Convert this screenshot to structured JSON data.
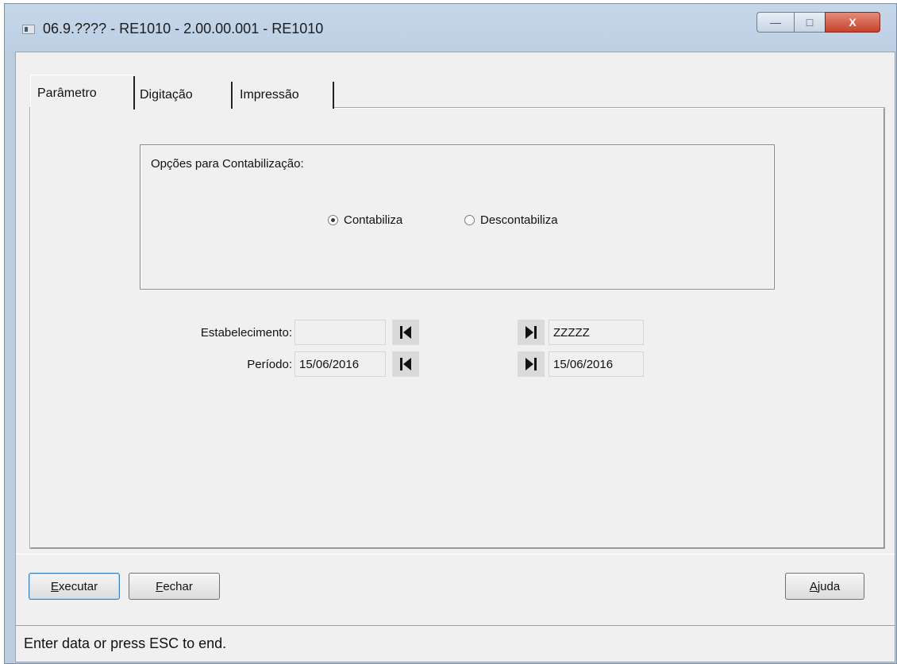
{
  "window": {
    "title": "06.9.???? - RE1010 - 2.00.00.001 - RE1010",
    "controls": {
      "minimize": "—",
      "maximize": "□",
      "close": "X"
    }
  },
  "tabs": [
    {
      "label": "Parâmetro",
      "active": true
    },
    {
      "label": "Digitação",
      "active": false
    },
    {
      "label": "Impressão",
      "active": false
    }
  ],
  "options_group": {
    "label": "Opções para Contabilização:",
    "radios": [
      {
        "label": "Contabiliza",
        "selected": true
      },
      {
        "label": "Descontabiliza",
        "selected": false
      }
    ]
  },
  "fields": {
    "estabelecimento": {
      "label": "Estabelecimento:",
      "from": "",
      "to": "ZZZZZ"
    },
    "periodo": {
      "label": "Período:",
      "from": "15/06/2016",
      "to": "15/06/2016"
    }
  },
  "buttons": {
    "executar": {
      "accel": "E",
      "rest": "xecutar"
    },
    "fechar": {
      "accel": "F",
      "rest": "echar"
    },
    "ajuda": {
      "accel": "A",
      "rest": "juda"
    }
  },
  "icons": {
    "first": "skip-to-first-icon",
    "last": "skip-to-last-icon"
  },
  "status_bar": "Enter data or press ESC to end."
}
